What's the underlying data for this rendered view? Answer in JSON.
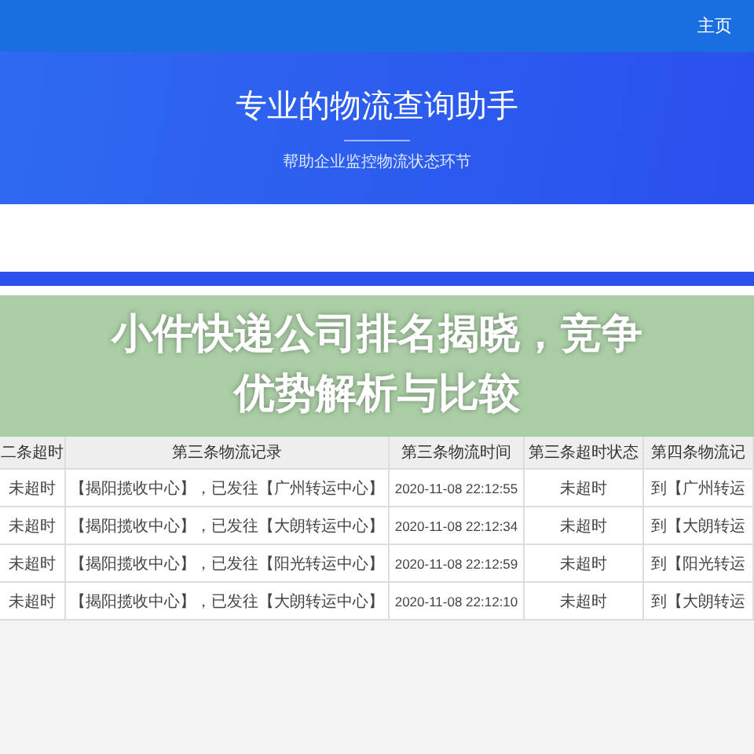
{
  "nav": {
    "home_link": "主页"
  },
  "hero": {
    "title": "专业的物流查询助手",
    "subtitle": "帮助企业监控物流状态环节"
  },
  "overlay": {
    "headline": "小件快递公司排名揭晓，竞争优势解析与比较"
  },
  "table": {
    "columns": [
      "二条超时",
      "第三条物流记录",
      "第三条物流时间",
      "第三条超时状态",
      "第四条物流记"
    ],
    "rows": [
      [
        "未超时",
        "【揭阳揽收中心】，已发往【广州转运中心】",
        "2020-11-08 22:12:55",
        "未超时",
        "到【广州转运"
      ],
      [
        "未超时",
        "【揭阳揽收中心】，已发往【大朗转运中心】",
        "2020-11-08 22:12:34",
        "未超时",
        "到【大朗转运"
      ],
      [
        "未超时",
        "【揭阳揽收中心】，已发往【阳光转运中心】",
        "2020-11-08 22:12:59",
        "未超时",
        "到【阳光转运"
      ],
      [
        "未超时",
        "【揭阳揽收中心】，已发往【大朗转运中心】",
        "2020-11-08 22:12:10",
        "未超时",
        "到【大朗转运"
      ]
    ]
  }
}
